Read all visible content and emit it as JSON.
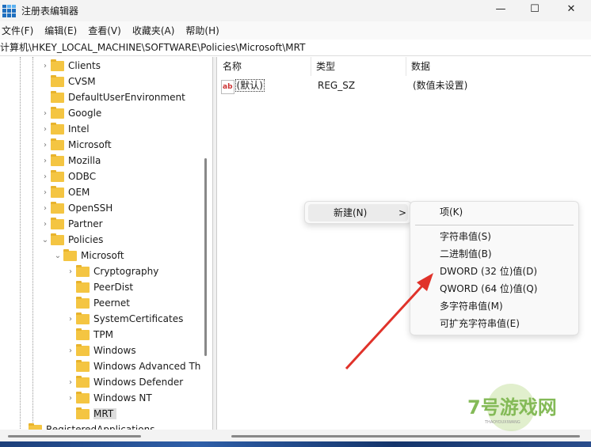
{
  "window": {
    "title": "注册表编辑器",
    "minimize": "—",
    "maximize": "☐",
    "close": "✕"
  },
  "menubar": [
    "文件(F)",
    "编辑(E)",
    "查看(V)",
    "收藏夹(A)",
    "帮助(H)"
  ],
  "address": "计算机\\HKEY_LOCAL_MACHINE\\SOFTWARE\\Policies\\Microsoft\\MRT",
  "tree": [
    {
      "label": "Clients",
      "level": 1,
      "expander": "collapsed"
    },
    {
      "label": "CVSM",
      "level": 1,
      "expander": "none"
    },
    {
      "label": "DefaultUserEnvironment",
      "level": 1,
      "expander": "none"
    },
    {
      "label": "Google",
      "level": 1,
      "expander": "collapsed"
    },
    {
      "label": "Intel",
      "level": 1,
      "expander": "collapsed"
    },
    {
      "label": "Microsoft",
      "level": 1,
      "expander": "collapsed"
    },
    {
      "label": "Mozilla",
      "level": 1,
      "expander": "collapsed"
    },
    {
      "label": "ODBC",
      "level": 1,
      "expander": "collapsed"
    },
    {
      "label": "OEM",
      "level": 1,
      "expander": "collapsed"
    },
    {
      "label": "OpenSSH",
      "level": 1,
      "expander": "collapsed"
    },
    {
      "label": "Partner",
      "level": 1,
      "expander": "collapsed"
    },
    {
      "label": "Policies",
      "level": 1,
      "expander": "expanded"
    },
    {
      "label": "Microsoft",
      "level": 2,
      "expander": "expanded"
    },
    {
      "label": "Cryptography",
      "level": 3,
      "expander": "collapsed"
    },
    {
      "label": "PeerDist",
      "level": 3,
      "expander": "none"
    },
    {
      "label": "Peernet",
      "level": 3,
      "expander": "none"
    },
    {
      "label": "SystemCertificates",
      "level": 3,
      "expander": "collapsed"
    },
    {
      "label": "TPM",
      "level": 3,
      "expander": "none"
    },
    {
      "label": "Windows",
      "level": 3,
      "expander": "collapsed"
    },
    {
      "label": "Windows Advanced Th",
      "level": 3,
      "expander": "none"
    },
    {
      "label": "Windows Defender",
      "level": 3,
      "expander": "collapsed"
    },
    {
      "label": "Windows NT",
      "level": 3,
      "expander": "collapsed"
    },
    {
      "label": "MRT",
      "level": 3,
      "expander": "none",
      "selected": true
    },
    {
      "label": "RegisteredApplications",
      "level": 0,
      "expander": "none"
    }
  ],
  "list": {
    "headers": [
      "名称",
      "类型",
      "数据"
    ],
    "rows": [
      {
        "name": "(默认)",
        "type": "REG_SZ",
        "data": "(数值未设置)"
      }
    ]
  },
  "context_menu": {
    "item": "新建(N)",
    "arrow": ">"
  },
  "submenu": [
    "项(K)",
    "字符串值(S)",
    "二进制值(B)",
    "DWORD (32 位)值(D)",
    "QWORD (64 位)值(Q)",
    "多字符串值(M)",
    "可扩充字符串值(E)"
  ],
  "watermark": {
    "text": "7号游戏网",
    "sub": "THAOYOUXIWANG"
  },
  "colors": {
    "arrow": "#e0322a",
    "folder": "#f4c542",
    "accent": "#1f6fbf"
  }
}
